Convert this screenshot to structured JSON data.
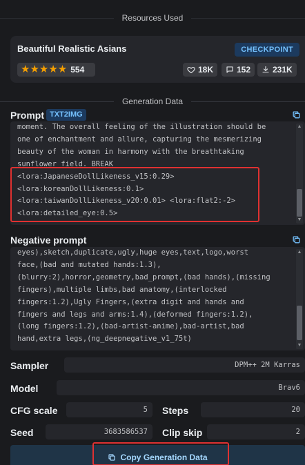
{
  "sections": {
    "resources_used": "Resources Used",
    "generation_data": "Generation Data"
  },
  "resource": {
    "name": "Beautiful Realistic Asians",
    "type_badge": "CHECKPOINT",
    "stars": "★★★★★",
    "rating_count": "554",
    "likes": "18K",
    "comments": "152",
    "downloads": "231K"
  },
  "prompt": {
    "label": "Prompt",
    "mode_tag": "TXT2IMG",
    "text": "moment. The overall feeling of the illustration should be\none of enchantment and allure, capturing the mesmerizing\nbeauty of the woman in harmony with the breathtaking\nsunflower field. BREAK\n<lora:JapaneseDollLikeness_v15:0.29>\n<lora:koreanDollLikeness:0.1>\n<lora:taiwanDollLikeness_v20:0.01> <lora:flat2:-2>\n<lora:detailed_eye:0.5>"
  },
  "negative_prompt": {
    "label": "Negative prompt",
    "text": "eyes),sketch,duplicate,ugly,huge eyes,text,logo,worst\nface,(bad and mutated hands:1.3),\n(blurry:2),horror,geometry,bad_prompt,(bad hands),(missing\nfingers),multiple limbs,bad anatomy,(interlocked\nfingers:1.2),Ugly Fingers,(extra digit and hands and\nfingers and legs and arms:1.4),(deformed fingers:1.2),\n(long fingers:1.2),(bad-artist-anime),bad-artist,bad\nhand,extra legs,(ng_deepnegative_v1_75t)"
  },
  "params": {
    "sampler_label": "Sampler",
    "sampler_value": "DPM++ 2M Karras",
    "model_label": "Model",
    "model_value": "Brav6",
    "cfg_label": "CFG scale",
    "cfg_value": "5",
    "steps_label": "Steps",
    "steps_value": "20",
    "seed_label": "Seed",
    "seed_value": "3683586537",
    "clip_label": "Clip skip",
    "clip_value": "2"
  },
  "actions": {
    "copy_generation_data": "Copy Generation Data"
  },
  "colors": {
    "accent": "#74c0fc",
    "highlight_box": "#e03131",
    "star": "#f59f00"
  }
}
